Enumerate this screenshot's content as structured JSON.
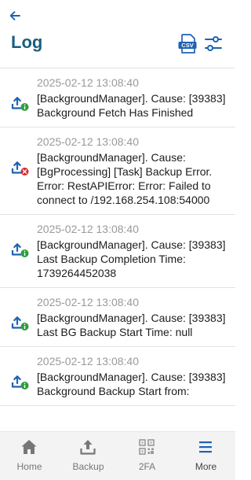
{
  "header": {
    "title": "Log",
    "back_icon": "back-arrow-icon",
    "export_icon": "csv-export-icon",
    "filter_icon": "filter-sliders-icon"
  },
  "colors": {
    "title": "#1a5f80",
    "icon_blue": "#1f62b3",
    "success_badge": "#2e9d3b",
    "error_badge": "#d9282f",
    "timestamp": "#9a9a9a",
    "nav_background": "#f3f3f3"
  },
  "log_entries": [
    {
      "status": "success",
      "icon": "upload-success-icon",
      "timestamp": "2025-02-12 13:08:40",
      "message": "[BackgroundManager]. Cause: [39383] Background Fetch Has Finished"
    },
    {
      "status": "error",
      "icon": "upload-error-icon",
      "timestamp": "2025-02-12 13:08:40",
      "message": "[BackgroundManager]. Cause: [BgProcessing] [Task] Backup Error. Error: RestAPIError: Error: Failed to connect to /192.168.254.108:54000"
    },
    {
      "status": "success",
      "icon": "upload-success-icon",
      "timestamp": "2025-02-12 13:08:40",
      "message": "[BackgroundManager]. Cause: [39383] Last Backup Completion Time: 1739264452038"
    },
    {
      "status": "success",
      "icon": "upload-success-icon",
      "timestamp": "2025-02-12 13:08:40",
      "message": "[BackgroundManager]. Cause: [39383] Last BG Backup Start Time: null"
    },
    {
      "status": "success",
      "icon": "upload-success-icon",
      "timestamp": "2025-02-12 13:08:40",
      "message": "[BackgroundManager]. Cause: [39383] Background Backup Start from:"
    }
  ],
  "nav": {
    "items": [
      {
        "label": "Home",
        "icon": "home-icon"
      },
      {
        "label": "Backup",
        "icon": "backup-upload-icon"
      },
      {
        "label": "2FA",
        "icon": "qr-code-icon"
      },
      {
        "label": "More",
        "icon": "menu-icon"
      }
    ],
    "active": "More"
  }
}
